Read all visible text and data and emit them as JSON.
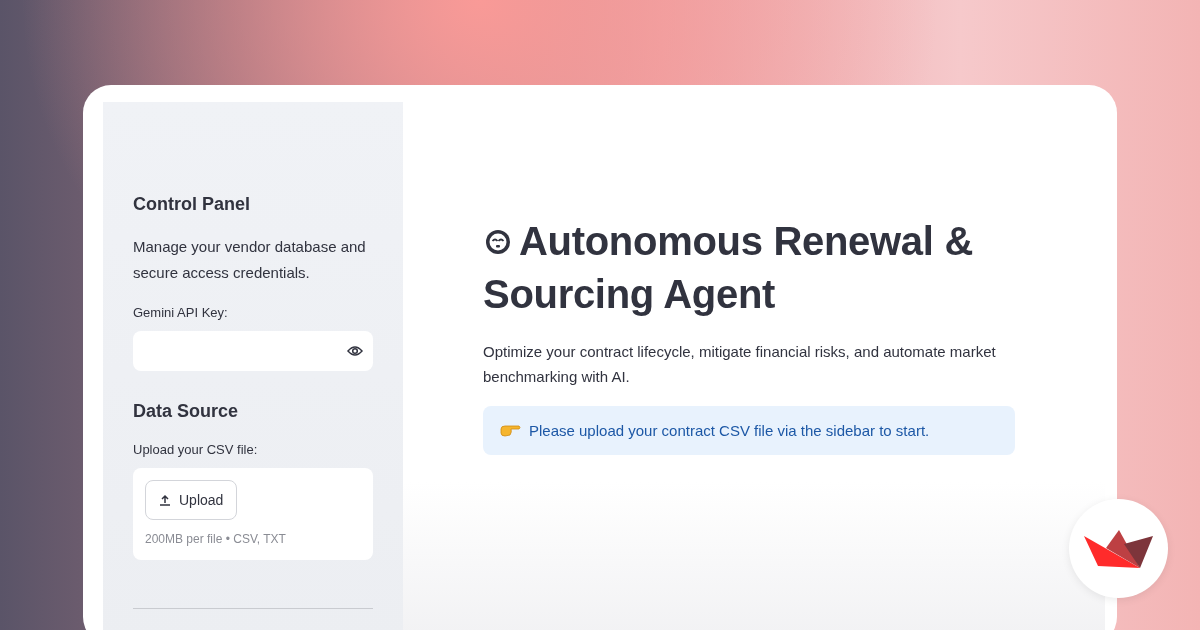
{
  "sidebar": {
    "heading": "Control Panel",
    "description": "Manage your vendor database and secure access credentials.",
    "api_key": {
      "label": "Gemini API Key:"
    },
    "data_source": {
      "heading": "Data Source",
      "label": "Upload your CSV file:",
      "button": "Upload",
      "hint": "200MB per file • CSV, TXT"
    }
  },
  "main": {
    "title": "Autonomous Renewal & Sourcing Agent",
    "description": "Optimize your contract lifecycle, mitigate financial risks, and automate market benchmarking with AI.",
    "info": "Please upload your contract CSV file via the sidebar to start."
  }
}
